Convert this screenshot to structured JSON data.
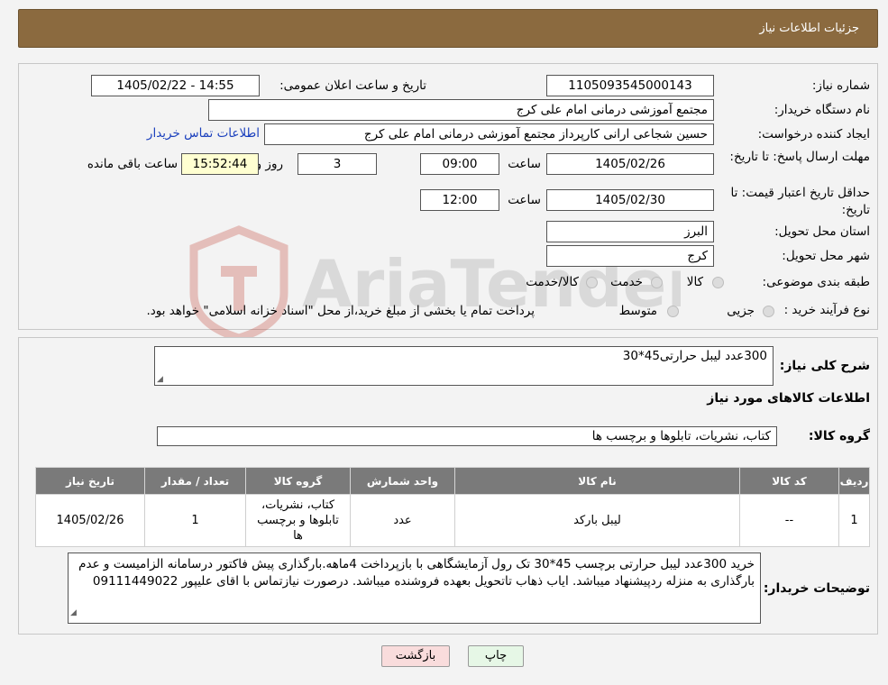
{
  "header": {
    "title": "جزئیات اطلاعات نیاز"
  },
  "fields": {
    "need_number_label": "شماره نیاز:",
    "need_number": "1105093545000143",
    "announce_label": "تاریخ و ساعت اعلان عمومی:",
    "announce_value": "1405/02/22 - 14:55",
    "buyer_org_label": "نام دستگاه خریدار:",
    "buyer_org": "مجتمع آموزشی درمانی امام علی کرج",
    "requester_label": "ایجاد کننده درخواست:",
    "requester": "حسین شجاعی ارانی کارپرداز مجتمع آموزشی درمانی امام علی کرج",
    "contact_link": "اطلاعات تماس خریدار",
    "reply_deadline_label": "مهلت ارسال پاسخ: تا تاریخ:",
    "reply_date": "1405/02/26",
    "time_label": "ساعت",
    "reply_time": "09:00",
    "days": "3",
    "days_label": "روز و",
    "remaining_time": "15:52:44",
    "remaining_label": "ساعت باقی مانده",
    "price_validity_label": "حداقل تاریخ اعتبار قیمت: تا تاریخ:",
    "validity_date": "1405/02/30",
    "validity_time": "12:00",
    "province_label": "استان محل تحویل:",
    "province": "البرز",
    "city_label": "شهر محل تحویل:",
    "city": "کرج",
    "category_label": "طبقه بندی موضوعی:",
    "category_options": [
      "کالا",
      "خدمت",
      "کالا/خدمت"
    ],
    "process_label": "نوع فرآیند خرید :",
    "process_options": [
      "جزیی",
      "متوسط"
    ],
    "process_note": "پرداخت تمام یا بخشی از مبلغ خرید،از محل \"اسناد خزانه اسلامی\" خواهد بود."
  },
  "summary": {
    "desc_label": "شرح کلی نیاز:",
    "desc": "300عدد لیبل حرارتی45*30",
    "goods_info_title": "اطلاعات کالاهای مورد نیاز",
    "group_label": "گروه کالا:",
    "group": "کتاب، نشریات، تابلوها و برچسب ها"
  },
  "table": {
    "headers": [
      "ردیف",
      "کد کالا",
      "نام کالا",
      "واحد شمارش",
      "گروه کالا",
      "تعداد / مقدار",
      "تاریخ نیاز"
    ],
    "rows": [
      [
        "1",
        "--",
        "لیبل بارکد",
        "عدد",
        "کتاب، نشریات، تابلوها و برچسب ها",
        "1",
        "1405/02/26"
      ]
    ]
  },
  "buyer_notes": {
    "label": "توضیحات خریدار:",
    "text": "خرید 300عدد لیبل حرارتی برچسب 45*30 تک رول آزمایشگاهی با بازپرداخت 4ماهه.بارگذاری پیش فاکتور درسامانه الزامیست و عدم بارگذاری به منزله ردپیشنهاد میباشد. ایاب ذهاب تاتحویل بعهده فروشنده میباشد. درصورت نیازتماس با اقای علیپور 09111449022"
  },
  "buttons": {
    "print": "چاپ",
    "back": "بازگشت"
  },
  "watermark": {
    "text": "AriaTender.neT"
  },
  "colors": {
    "header": "#8b6a3f",
    "link": "#1a3fbd",
    "back_button": "#f9dcdc",
    "print_button": "#e6f7e6",
    "remaining_box": "#ffffd1"
  }
}
